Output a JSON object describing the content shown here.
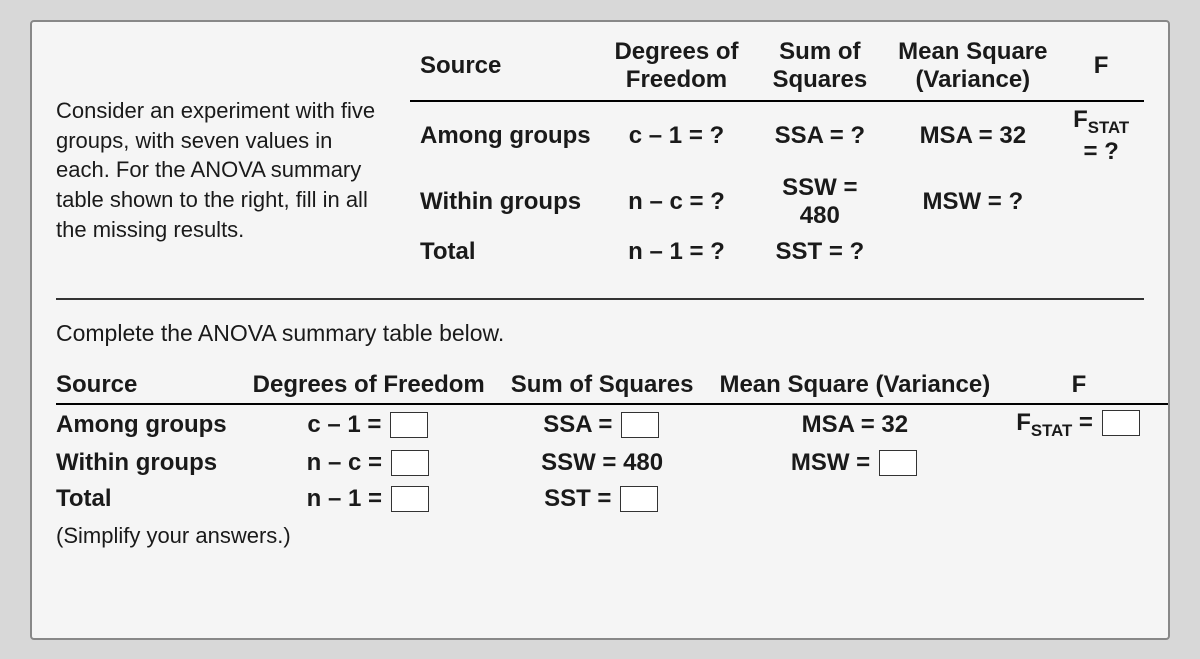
{
  "intro_text": "Consider an experiment with five groups, with seven values in each. For the ANOVA summary table shown to the right, fill in all the missing results.",
  "ref_table": {
    "headers": {
      "source": "Source",
      "df": "Degrees of Freedom",
      "ss": "Sum of Squares",
      "ms": "Mean Square (Variance)",
      "f": "F"
    },
    "rows": {
      "among": {
        "label": "Among groups",
        "df": "c – 1 = ?",
        "ss": "SSA = ?",
        "ms": "MSA = 32",
        "f_prefix": "F",
        "f_sub": "STAT",
        "f_suffix": " = ?"
      },
      "within": {
        "label": "Within groups",
        "df": "n – c = ?",
        "ss": "SSW = 480",
        "ms": "MSW = ?"
      },
      "total": {
        "label": "Total",
        "df": "n – 1 = ?",
        "ss": "SST = ?"
      }
    }
  },
  "instruction": "Complete the ANOVA summary table below.",
  "fill_table": {
    "headers": {
      "source": "Source",
      "df": "Degrees of Freedom",
      "ss": "Sum of Squares",
      "ms": "Mean Square (Variance)",
      "f": "F"
    },
    "rows": {
      "among": {
        "label": "Among groups",
        "df_prefix": "c – 1 =",
        "ss_prefix": "SSA =",
        "ms": "MSA = 32",
        "f_prefix": "F",
        "f_sub": "STAT",
        "f_eq": " ="
      },
      "within": {
        "label": "Within groups",
        "df_prefix": "n – c =",
        "ss": "SSW = 480",
        "ms_prefix": "MSW ="
      },
      "total": {
        "label": "Total",
        "df_prefix": "n – 1 =",
        "ss_prefix": "SST ="
      }
    }
  },
  "simplify_note": "(Simplify your answers.)",
  "chart_data": {
    "type": "table",
    "title": "ANOVA Summary Table",
    "given": {
      "num_groups": 5,
      "values_per_group": 7,
      "MSA": 32,
      "SSW": 480
    },
    "columns": [
      "Source",
      "Degrees of Freedom",
      "Sum of Squares",
      "Mean Square (Variance)",
      "F"
    ],
    "rows": [
      {
        "Source": "Among groups",
        "Degrees of Freedom": "c-1 = ?",
        "Sum of Squares": "SSA = ?",
        "Mean Square (Variance)": "MSA = 32",
        "F": "F_STAT = ?"
      },
      {
        "Source": "Within groups",
        "Degrees of Freedom": "n-c = ?",
        "Sum of Squares": "SSW = 480",
        "Mean Square (Variance)": "MSW = ?",
        "F": ""
      },
      {
        "Source": "Total",
        "Degrees of Freedom": "n-1 = ?",
        "Sum of Squares": "SST = ?",
        "Mean Square (Variance)": "",
        "F": ""
      }
    ]
  }
}
